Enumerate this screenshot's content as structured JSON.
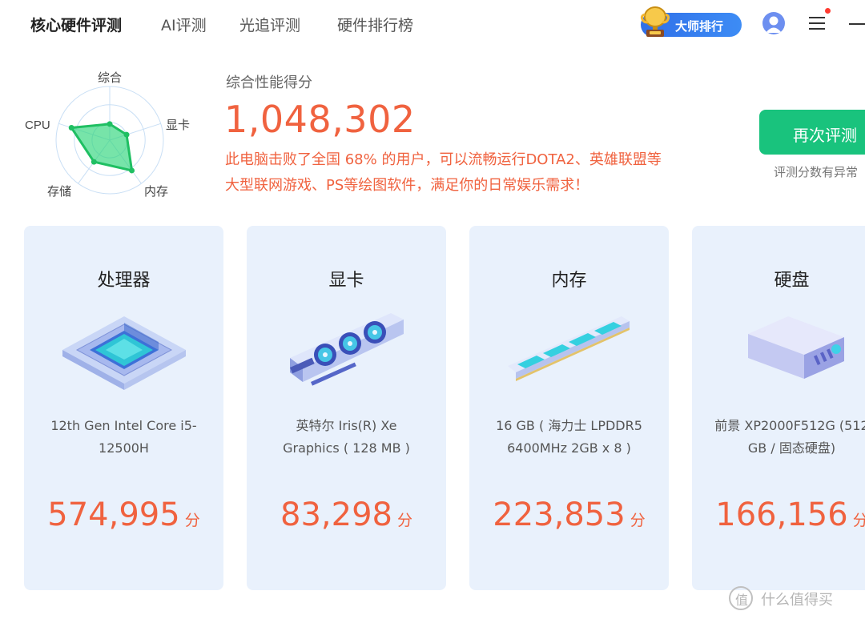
{
  "nav": {
    "tabs": [
      {
        "label": "核心硬件评测",
        "active": true
      },
      {
        "label": "AI评测",
        "active": false
      },
      {
        "label": "光追评测",
        "active": false
      },
      {
        "label": "硬件排行榜",
        "active": false
      }
    ],
    "master_button": "大师排行",
    "icons": {
      "avatar": "user-avatar-icon",
      "menu": "hamburger-menu-icon",
      "minimize": "minimize-icon",
      "notification": "red-dot"
    }
  },
  "radar": {
    "axes": [
      "综合",
      "显卡",
      "内存",
      "存储",
      "CPU"
    ],
    "values": [
      0.3,
      0.33,
      0.7,
      0.5,
      0.75
    ],
    "fill_color": "#2ed67b",
    "line_color": "#1fbf62"
  },
  "summary": {
    "label": "综合性能得分",
    "score": "1,048,302",
    "desc_line1": "此电脑击败了全国 68% 的用户，可以流畅运行DOTA2、英雄联盟等",
    "desc_line2": "大型联网游戏、PS等绘图软件，满足你的日常娱乐需求！"
  },
  "actions": {
    "retest": "再次评测",
    "retest_note": "评测分数有异常"
  },
  "cards": [
    {
      "title": "处理器",
      "desc_line1": "12th Gen Intel Core i5-",
      "desc_line2": "12500H",
      "score": "574,995",
      "unit": "分"
    },
    {
      "title": "显卡",
      "desc_line1": "英特尔 Iris(R) Xe",
      "desc_line2": "Graphics ( 128 MB )",
      "score": "83,298",
      "unit": "分"
    },
    {
      "title": "内存",
      "desc_line1": "16 GB ( 海力士 LPDDR5",
      "desc_line2": "6400MHz 2GB x 8 )",
      "score": "223,853",
      "unit": "分"
    },
    {
      "title": "硬盘",
      "desc_line1": "前景 XP2000F512G (512",
      "desc_line2": "GB / 固态硬盘)",
      "score": "166,156",
      "unit": "分"
    }
  ],
  "watermark": {
    "icon_char": "值",
    "text": "什么值得买"
  },
  "colors": {
    "accent": "#f0623f",
    "green": "#19c37d",
    "card_bg": "#e9f1fc",
    "brand_blue": "#2f6fe8"
  }
}
